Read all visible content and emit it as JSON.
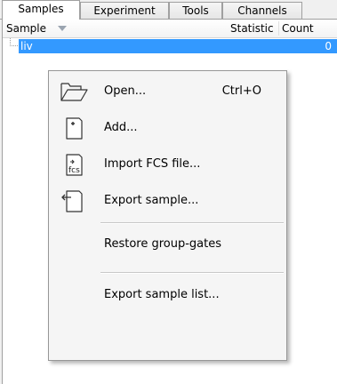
{
  "tabs": [
    {
      "label": "Samples",
      "active": true
    },
    {
      "label": "Experiment",
      "active": false
    },
    {
      "label": "Tools",
      "active": false
    },
    {
      "label": "Channels",
      "active": false
    }
  ],
  "columns": {
    "sample": "Sample",
    "statistic": "Statistic",
    "count": "Count"
  },
  "selected_row": {
    "name": "liv",
    "count": "0"
  },
  "menu": {
    "open": {
      "label": "Open...",
      "shortcut": "Ctrl+O",
      "icon": "folder-open-icon"
    },
    "add": {
      "label": "Add...",
      "icon": "add-document-icon"
    },
    "import": {
      "label": "Import FCS file...",
      "icon": "fcs-file-icon",
      "icon_text": "fcs"
    },
    "export": {
      "label": "Export sample...",
      "icon": "export-document-icon"
    },
    "restore": {
      "label": "Restore group-gates"
    },
    "export_list": {
      "label": "Export sample list..."
    }
  },
  "colors": {
    "selection": "#3399ff",
    "menu_background": "#f5f5f5",
    "panel_background": "#ffffff"
  }
}
